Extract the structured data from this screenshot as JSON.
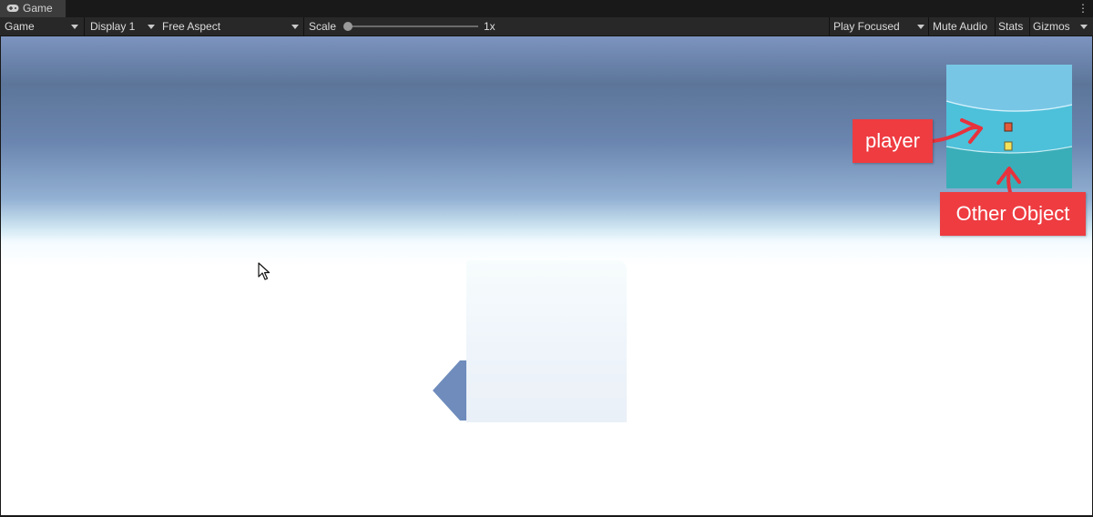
{
  "window": {
    "tab_label": "Game",
    "tab_icon": "gamepad-icon",
    "menu_icon": "kebab-menu-icon"
  },
  "toolbar": {
    "view_dropdown": "Game",
    "display_dropdown": "Display 1",
    "aspect_dropdown": "Free Aspect",
    "scale_label": "Scale",
    "scale_value": "1x",
    "play_focused_dropdown": "Play Focused",
    "mute_audio": "Mute Audio",
    "stats": "Stats",
    "gizmos": "Gizmos"
  },
  "annotations": {
    "player_label": "player",
    "other_object_label": "Other Object",
    "callout_color": "#ee3c41",
    "arrow_color": "#e8323c"
  },
  "minimap": {
    "player_marker_color": "#e35b3b",
    "other_object_marker_color": "#f5e25a"
  }
}
